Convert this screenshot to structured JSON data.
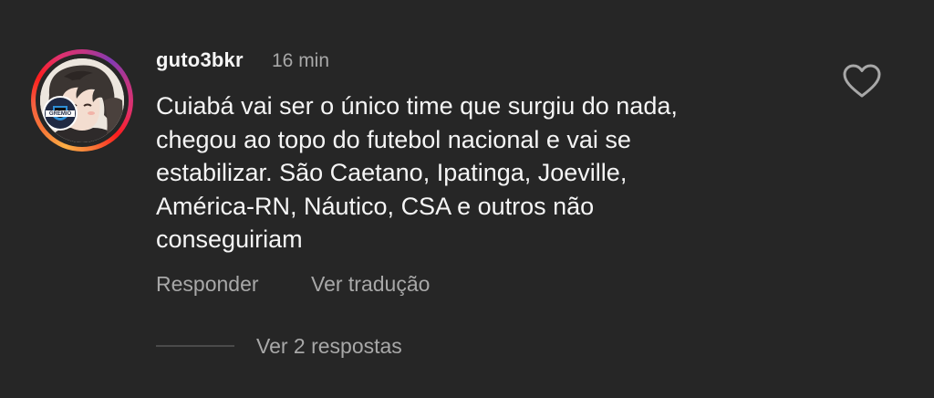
{
  "comment": {
    "username": "guto3bkr",
    "time": "16 min",
    "body_lines": [
      "Cuiabá vai ser o único time que surgiu do nada,",
      "chegou ao topo do futebol nacional e vai se",
      "estabilizar. São Caetano, Ipatinga, Joeville,",
      "América-RN, Náutico, CSA e outros não",
      "conseguiriam"
    ],
    "actions": {
      "reply": "Responder",
      "translate": "Ver tradução"
    },
    "view_replies": "Ver 2 respostas",
    "avatar_badge": "GREMIO",
    "icons": {
      "like": "heart-outline-icon"
    }
  },
  "colors": {
    "background": "#262626",
    "primary_text": "#f5f5f5",
    "secondary_text": "#a8a8a8",
    "story_ring": [
      "#fcaf45",
      "#f77737",
      "#fd1d1d",
      "#e1306c",
      "#c13584",
      "#833ab4"
    ]
  }
}
